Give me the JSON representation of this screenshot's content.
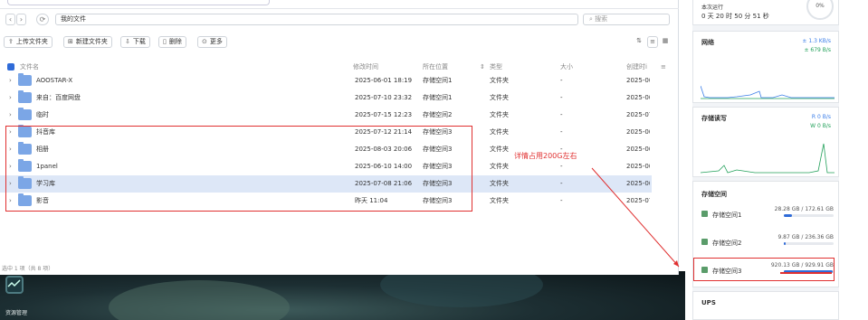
{
  "file_manager": {
    "path": "我的文件",
    "search_placeholder": "搜索",
    "toolbar": {
      "upload": "上传文件夹",
      "new_folder": "新建文件夹",
      "download": "下载",
      "delete": "删除",
      "more": "更多"
    },
    "columns": {
      "name": "文件名",
      "modified": "修改时间",
      "location": "所在位置",
      "type": "类型",
      "size": "大小",
      "created": "创建时i"
    },
    "rows": [
      {
        "name": "AOOSTAR-X",
        "modified": "2025-06-01 18:19",
        "location": "存储空间1",
        "type": "文件夹",
        "size": "-",
        "created": "2025-0("
      },
      {
        "name": "来自：百度网盘",
        "modified": "2025-07-10 23:32",
        "location": "存储空间1",
        "type": "文件夹",
        "size": "-",
        "created": "2025-0("
      },
      {
        "name": "临时",
        "modified": "2025-07-15 12:23",
        "location": "存储空间2",
        "type": "文件夹",
        "size": "-",
        "created": "2025-07"
      },
      {
        "name": "抖音库",
        "modified": "2025-07-12 21:14",
        "location": "存储空间3",
        "type": "文件夹",
        "size": "-",
        "created": "2025-0("
      },
      {
        "name": "相册",
        "modified": "2025-08-03 20:06",
        "location": "存储空间3",
        "type": "文件夹",
        "size": "-",
        "created": "2025-0("
      },
      {
        "name": "1panel",
        "modified": "2025-06-10 14:00",
        "location": "存储空间3",
        "type": "文件夹",
        "size": "-",
        "created": "2025-0("
      },
      {
        "name": "学习库",
        "modified": "2025-07-08 21:06",
        "location": "存储空间3",
        "type": "文件夹",
        "size": "-",
        "created": "2025-0("
      },
      {
        "name": "影音",
        "modified": "昨天 11:04",
        "location": "存储空间3",
        "type": "文件夹",
        "size": "-",
        "created": "2025-07"
      }
    ],
    "status": "选中 1 项（共 8 项）",
    "annotation": "详情占用200G左右"
  },
  "desktop": {
    "app_label": "资源管理"
  },
  "sidebar": {
    "uptime_label": "本次运行",
    "uptime_value": "0 天 20 时 50 分 51 秒",
    "cpu_percent": "0%",
    "network": {
      "title": "网络",
      "up": "± 1.3 KB/s",
      "down": "± 679 B/s"
    },
    "disk": {
      "title": "存储读写",
      "read": "R 0 B/s",
      "write": "W 0 B/s"
    },
    "storage": {
      "title": "存储空间",
      "items": [
        {
          "name": "存储空间1",
          "usage": "28.28 GB / 172.61 GB",
          "fraction": 0.164
        },
        {
          "name": "存储空间2",
          "usage": "9.87 GB / 236.36 GB",
          "fraction": 0.042
        },
        {
          "name": "存储空间3",
          "usage": "920.13 GB / 929.91 GB",
          "fraction": 0.989
        }
      ]
    },
    "ups": {
      "title": "UPS"
    }
  },
  "colors": {
    "accent": "#2f6bd8",
    "highlight": "#e03030",
    "selected_row": "#dde7f7"
  }
}
